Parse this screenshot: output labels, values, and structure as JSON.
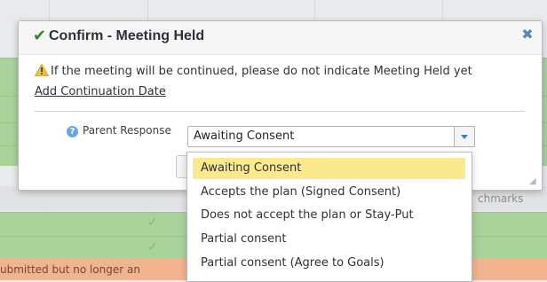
{
  "background": {
    "partial_text_right": "chmarks",
    "partial_text_bottom": "ubmitted but no longer an",
    "checkmark_glyph": "✓"
  },
  "modal": {
    "title": "Confirm - Meeting Held",
    "title_icon": "check-icon",
    "close_icon": "close-icon",
    "warning_text": "If the meeting will be continued, please do not indicate Meeting Held yet",
    "warning_icon": "warning-icon",
    "add_link": "Add Continuation Date",
    "field_label": "Parent Response",
    "help_icon": "question-circle-icon",
    "select_value": "Awaiting Consent"
  },
  "dropdown": {
    "options": [
      "Awaiting Consent",
      "Accepts the plan (Signed Consent)",
      "Does not accept the plan or Stay-Put",
      "Partial consent",
      "Partial consent (Agree to Goals)"
    ],
    "highlighted_index": 0
  },
  "colors": {
    "row_green": "#a9d39b",
    "row_salmon": "#f2b48e",
    "title_check": "#2f8a2f",
    "highlight": "#fbe98d",
    "link_blue": "#3f7fbf"
  }
}
